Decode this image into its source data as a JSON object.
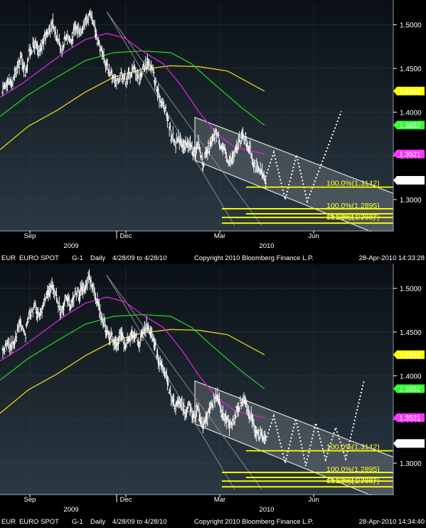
{
  "chart_data": [
    {
      "type": "candlestick",
      "footer": {
        "ticker": "EUR",
        "security": "EURO SPOT",
        "page": "G-1",
        "frequency": "Daily",
        "range": "4/28/09 to 4/28/10",
        "copyright": "Copyright 2010 Bloomberg Finance L.P.",
        "timestamp": "28-Apr-2010 14:33:28"
      },
      "x_ticks": [
        "Sep",
        "Dec",
        "Mar",
        "Jun"
      ],
      "x_year_labels": [
        "2009",
        "2010"
      ],
      "y_ticks": [
        "1.5000",
        "1.4500",
        "1.4000",
        "1.3500",
        "1.3000"
      ],
      "ylim": [
        1.265,
        1.525
      ],
      "grid": true,
      "price_tags": [
        {
          "label": "1.4241",
          "value": 1.4241,
          "color": "#ffff00"
        },
        {
          "label": "1.3852",
          "value": 1.3852,
          "color": "#33ff33"
        },
        {
          "label": "1.3521",
          "value": 1.3521,
          "color": "#ff33ff"
        },
        {
          "label": "1.3221",
          "value": 1.3221,
          "color": "#ffffff"
        }
      ],
      "fib_levels": [
        {
          "label": "100.0%(1.3142)",
          "value": 1.3142
        },
        {
          "label": "100.0%(1.2895)",
          "value": 1.2895
        },
        {
          "label": "161.8%(1.2837)",
          "value": 1.2837
        },
        {
          "label": "61.8%(1.2795)",
          "value": 1.2795
        }
      ],
      "close_path": [
        1.423,
        1.437,
        1.432,
        1.447,
        1.462,
        1.448,
        1.471,
        1.478,
        1.466,
        1.482,
        1.495,
        1.501,
        1.486,
        1.472,
        1.489,
        1.481,
        1.496,
        1.494,
        1.503,
        1.511,
        1.498,
        1.482,
        1.462,
        1.451,
        1.443,
        1.431,
        1.446,
        1.437,
        1.444,
        1.45,
        1.438,
        1.452,
        1.458,
        1.447,
        1.422,
        1.411,
        1.398,
        1.376,
        1.364,
        1.371,
        1.358,
        1.366,
        1.351,
        1.362,
        1.342,
        1.354,
        1.366,
        1.377,
        1.362,
        1.351,
        1.343,
        1.352,
        1.367,
        1.374,
        1.361,
        1.346,
        1.333,
        1.329,
        1.322
      ]
    },
    {
      "type": "candlestick",
      "footer": {
        "ticker": "EUR",
        "security": "EURO SPOT",
        "page": "G-1",
        "frequency": "Daily",
        "range": "4/28/09 to 4/28/10",
        "copyright": "Copyright 2010 Bloomberg Finance L.P.",
        "timestamp": "28-Apr-2010 14:34:40"
      },
      "x_ticks": [
        "Sep",
        "Dec",
        "Mar",
        "Jun"
      ],
      "x_year_labels": [
        "2009",
        "2010"
      ],
      "y_ticks": [
        "1.5000",
        "1.4500",
        "1.4000",
        "1.3500",
        "1.3000"
      ],
      "ylim": [
        1.265,
        1.525
      ],
      "grid": true,
      "price_tags": [
        {
          "label": "1.4241",
          "value": 1.4241,
          "color": "#ffff00"
        },
        {
          "label": "1.3852",
          "value": 1.3852,
          "color": "#33ff33"
        },
        {
          "label": "1.3521",
          "value": 1.3521,
          "color": "#ff33ff"
        },
        {
          "label": "1.3226",
          "value": 1.3226,
          "color": "#ffffff"
        }
      ],
      "fib_levels": [
        {
          "label": "100.0%(1.3142)",
          "value": 1.3142
        },
        {
          "label": "100.0%(1.2895)",
          "value": 1.2895
        },
        {
          "label": "161.8%(1.2837)",
          "value": 1.2837
        },
        {
          "label": "61.8%(1.2795)",
          "value": 1.2795
        }
      ],
      "close_path": [
        1.423,
        1.437,
        1.432,
        1.447,
        1.462,
        1.448,
        1.471,
        1.478,
        1.466,
        1.482,
        1.495,
        1.501,
        1.486,
        1.472,
        1.489,
        1.481,
        1.496,
        1.494,
        1.503,
        1.511,
        1.498,
        1.482,
        1.462,
        1.451,
        1.443,
        1.431,
        1.446,
        1.437,
        1.444,
        1.45,
        1.438,
        1.452,
        1.458,
        1.447,
        1.422,
        1.411,
        1.398,
        1.376,
        1.364,
        1.371,
        1.358,
        1.366,
        1.351,
        1.362,
        1.342,
        1.354,
        1.366,
        1.377,
        1.362,
        1.351,
        1.343,
        1.352,
        1.367,
        1.374,
        1.361,
        1.346,
        1.333,
        1.329,
        1.323
      ]
    }
  ]
}
